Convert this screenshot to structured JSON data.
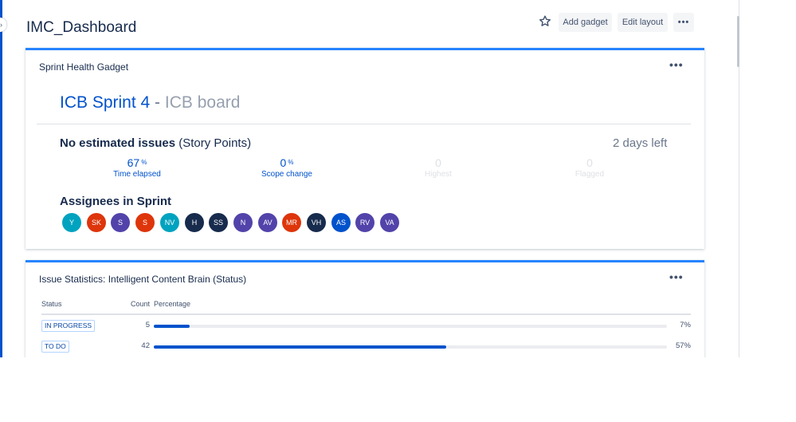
{
  "page": {
    "title": "IMC_Dashboard"
  },
  "toolbar": {
    "add_gadget": "Add gadget",
    "edit_layout": "Edit layout",
    "more": "•••"
  },
  "sprint_health": {
    "title": "Sprint Health Gadget",
    "more": "•••",
    "sprint_name": "ICB Sprint 4",
    "separator": " - ",
    "board_name": "ICB board",
    "estimate_bold": "No estimated issues",
    "estimate_rest": " (Story Points)",
    "days_left": "2 days left",
    "metrics": [
      {
        "value": "67",
        "unit": "%",
        "label": "Time elapsed",
        "active": true
      },
      {
        "value": "0",
        "unit": "%",
        "label": "Scope change",
        "active": true
      },
      {
        "value": "0",
        "unit": "",
        "label": "Highest",
        "active": false
      },
      {
        "value": "0",
        "unit": "",
        "label": "Flagged",
        "active": false
      }
    ],
    "assignees_title": "Assignees in Sprint",
    "assignees": [
      {
        "initials": "Y",
        "color": "#00a3bf"
      },
      {
        "initials": "SK",
        "color": "#de350b"
      },
      {
        "initials": "S",
        "color": "#5243aa"
      },
      {
        "initials": "S",
        "color": "#de350b"
      },
      {
        "initials": "NV",
        "color": "#00a3bf"
      },
      {
        "initials": "H",
        "color": "#172b4d"
      },
      {
        "initials": "SS",
        "color": "#172b4d"
      },
      {
        "initials": "N",
        "color": "#5243aa"
      },
      {
        "initials": "AV",
        "color": "#5243aa"
      },
      {
        "initials": "MR",
        "color": "#de350b"
      },
      {
        "initials": "VH",
        "color": "#172b4d"
      },
      {
        "initials": "AS",
        "color": "#0052cc"
      },
      {
        "initials": "RV",
        "color": "#5243aa"
      },
      {
        "initials": "VA",
        "color": "#5243aa"
      }
    ]
  },
  "issue_stats": {
    "title": "Issue Statistics: Intelligent Content Brain (Status)",
    "more": "•••",
    "columns": {
      "status": "Status",
      "count": "Count",
      "percentage": "Percentage"
    },
    "rows": [
      {
        "status": "IN PROGRESS",
        "count": "5",
        "percent": "7%",
        "fill": 0.07
      },
      {
        "status": "TO DO",
        "count": "42",
        "percent": "57%",
        "fill": 0.57
      }
    ]
  },
  "colors": {
    "accent": "#0052cc",
    "gadget_border": "#2684ff",
    "muted": "#97a0af"
  }
}
